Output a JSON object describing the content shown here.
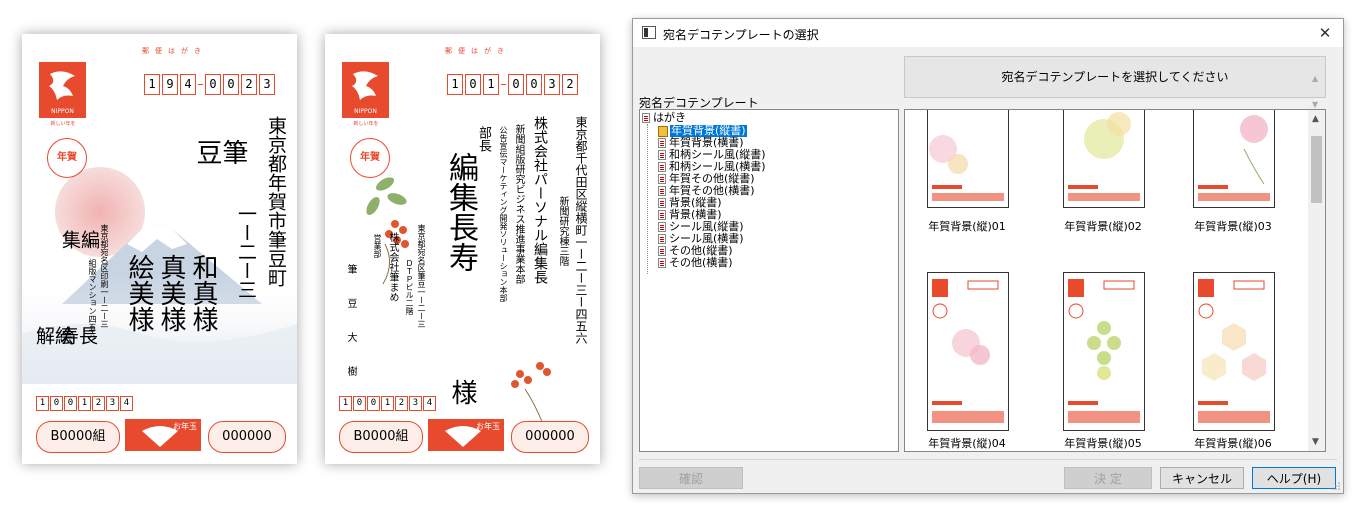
{
  "postcard_common": {
    "postal_label": "郵便はがき",
    "stamp_brand": "NIPPON",
    "stamp_caption": "新しい年を",
    "nenga": "年賀",
    "lottery_left": "B0000組",
    "otoshidama": "お年玉",
    "lottery_right": "000000"
  },
  "card1": {
    "zip": [
      "1",
      "9",
      "4",
      "0",
      "0",
      "2",
      "3"
    ],
    "address": "東京都年賀市筆豆町",
    "address2": "一ー二ー三",
    "names": [
      "筆",
      "豆"
    ],
    "name_line2": "和真様",
    "name_line3": "真美様",
    "name_line4": "絵美様",
    "sender_address": "東京都宛名区印刷一ー二ー三",
    "sender_address2": "組版マンション四五六",
    "sender_names": [
      "編",
      "集",
      "絵",
      "長",
      "解",
      "寿"
    ],
    "sender_zip": [
      "1",
      "0",
      "0",
      "1",
      "2",
      "3",
      "4"
    ]
  },
  "card2": {
    "zip": [
      "1",
      "0",
      "1",
      "0",
      "0",
      "3",
      "2"
    ],
    "address": "東京都千代田区縦横町一ー二ー三ー四五六",
    "address2": "新聞研究棟三階",
    "company": "株式会社パーソナル編集長",
    "dept": "新聞組版研究ビジネス推進事業本部",
    "dept2": "公告宣伝マーケティング開発ソリューション本部",
    "title": "部長",
    "name": "編集長寿",
    "honorific": "様",
    "sender_address": "東京都宛名区筆豆一ー二ー三",
    "sender_address2": "ＤＴＰビル二階",
    "sender_company": "株式会社筆まめ",
    "sender_dept": "営業部",
    "sender_name": "筆豆大樹",
    "sender_zip": [
      "1",
      "0",
      "0",
      "1",
      "2",
      "3",
      "4"
    ]
  },
  "dialog": {
    "title": "宛名デコテンプレートの選択",
    "instruction": "宛名デコテンプレートを選択してください",
    "tree_label": "宛名デコテンプレート",
    "tree_root": "はがき",
    "tree_items": [
      "年賀背景(縦書)",
      "年賀背景(横書)",
      "和柄シール風(縦書)",
      "和柄シール風(横書)",
      "年賀その他(縦書)",
      "年賀その他(横書)",
      "背景(縦書)",
      "背景(横書)",
      "シール風(縦書)",
      "シール風(横書)",
      "その他(縦書)",
      "その他(横書)"
    ],
    "selected_index": 0,
    "tiles": [
      "年賀背景(縦)01",
      "年賀背景(縦)02",
      "年賀背景(縦)03",
      "年賀背景(縦)04",
      "年賀背景(縦)05",
      "年賀背景(縦)06"
    ],
    "buttons": {
      "confirm": "確認",
      "ok": "決 定",
      "cancel": "キャンセル",
      "help": "ヘルプ(H)"
    },
    "close_glyph": "✕"
  },
  "colors": {
    "accent_red": "#e84a2e",
    "selection_blue": "#0078d7"
  }
}
